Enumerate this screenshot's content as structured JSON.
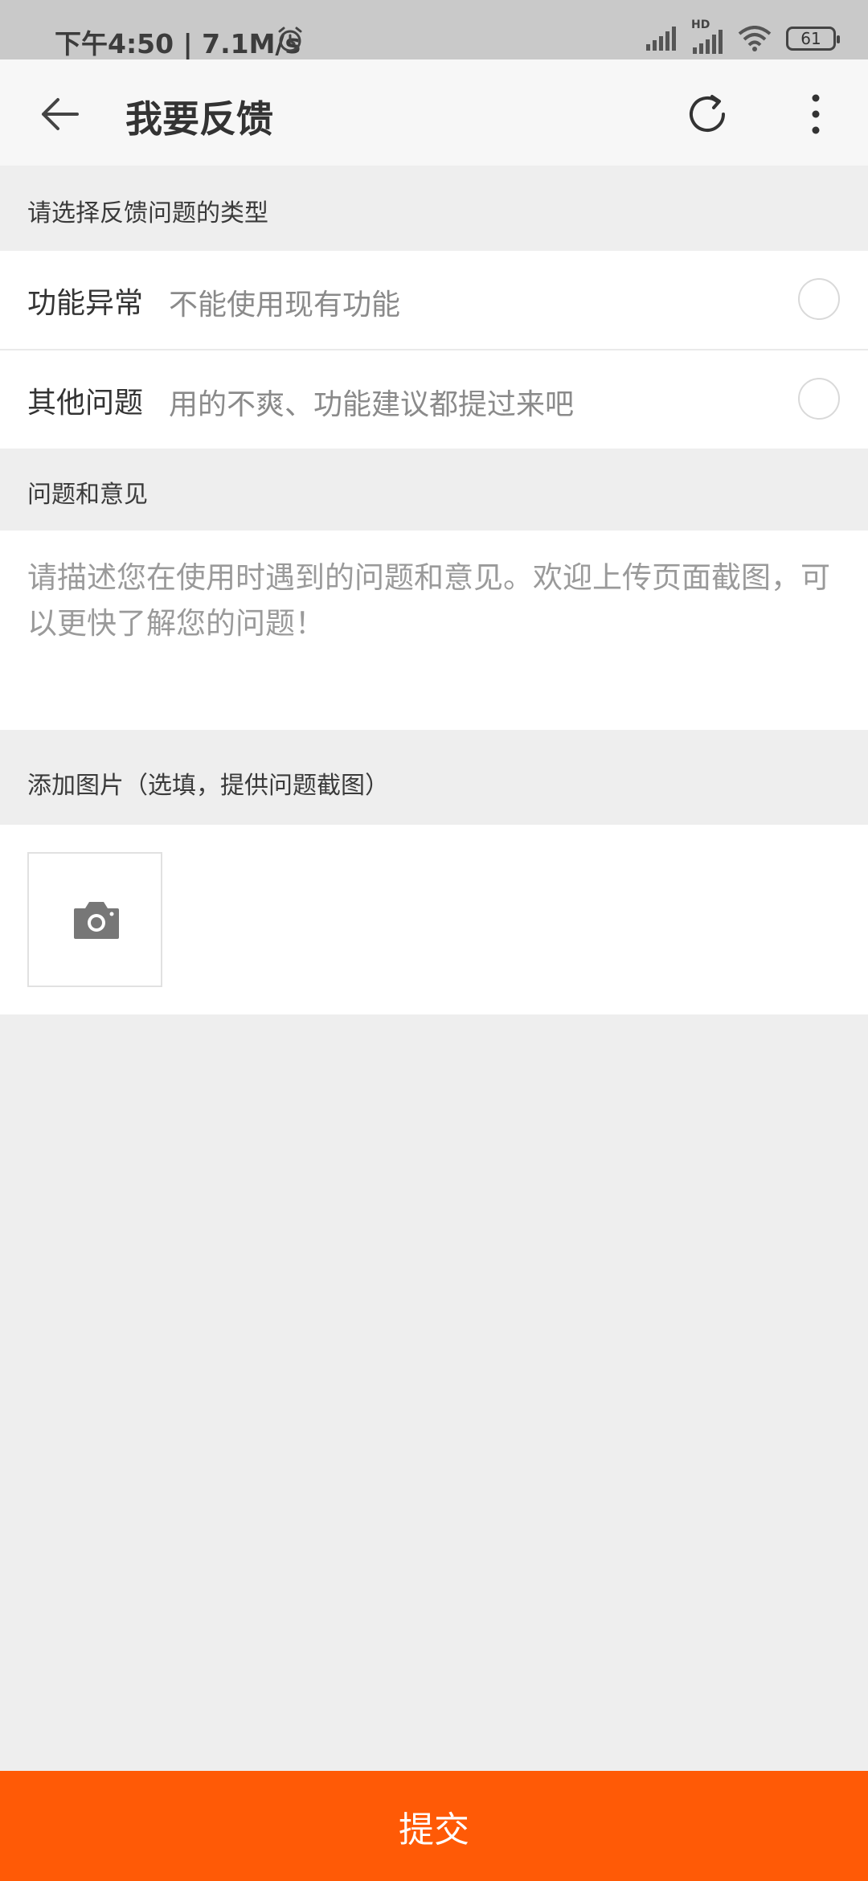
{
  "status_bar": {
    "time_speed": "下午4:50 | 7.1M/s",
    "battery": "61",
    "network_label": "HD"
  },
  "header": {
    "title": "我要反馈",
    "back_icon": "arrow-left-icon",
    "refresh_icon": "refresh-icon",
    "more_icon": "more-vertical-icon"
  },
  "type_section": {
    "label": "请选择反馈问题的类型",
    "options": [
      {
        "title": "功能异常",
        "description": "不能使用现有功能",
        "selected": false
      },
      {
        "title": "其他问题",
        "description": "用的不爽、功能建议都提过来吧",
        "selected": false
      }
    ]
  },
  "feedback_section": {
    "label": "问题和意见",
    "value": "",
    "placeholder": "请描述您在使用时遇到的问题和意见。欢迎上传页面截图，可以更快了解您的问题！"
  },
  "image_section": {
    "label": "添加图片（选填，提供问题截图）",
    "add_icon": "camera-icon"
  },
  "submit": {
    "label": "提交",
    "color": "#ff5a06"
  }
}
